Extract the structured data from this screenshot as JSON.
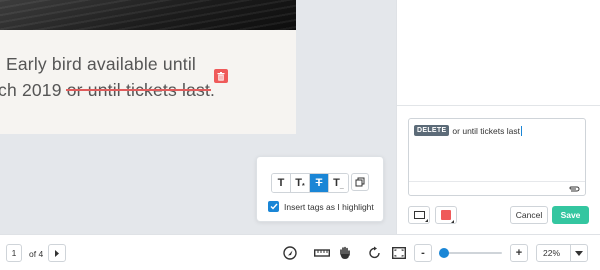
{
  "document": {
    "line1": "Early bird available until",
    "line2_prefix": "ch 2019 ",
    "line2_struck": "or until tickets last",
    "line2_suffix": "."
  },
  "highlight_popup": {
    "tools": [
      "T",
      "T",
      "T",
      "T"
    ],
    "active_tool_index": 2,
    "checkbox_label": "Insert tags as I highlight",
    "checkbox_checked": true
  },
  "comment": {
    "tag": "DELETE",
    "value": "or until tickets last"
  },
  "actions": {
    "cancel_label": "Cancel",
    "save_label": "Save"
  },
  "colors": {
    "accent_blue": "#1a86d6",
    "save_green": "#34c6a0",
    "delete_red": "#ef5a5a"
  },
  "pagination": {
    "current_page": "1",
    "total_label": "of 4"
  },
  "zoom": {
    "level_label": "22%",
    "minus_label": "-",
    "plus_label": "+",
    "slider_fraction": 0.06
  },
  "icons": {
    "toolbar": [
      "navigate-icon",
      "ruler-icon",
      "hand-icon",
      "rotate-icon",
      "fit-page-icon"
    ]
  }
}
